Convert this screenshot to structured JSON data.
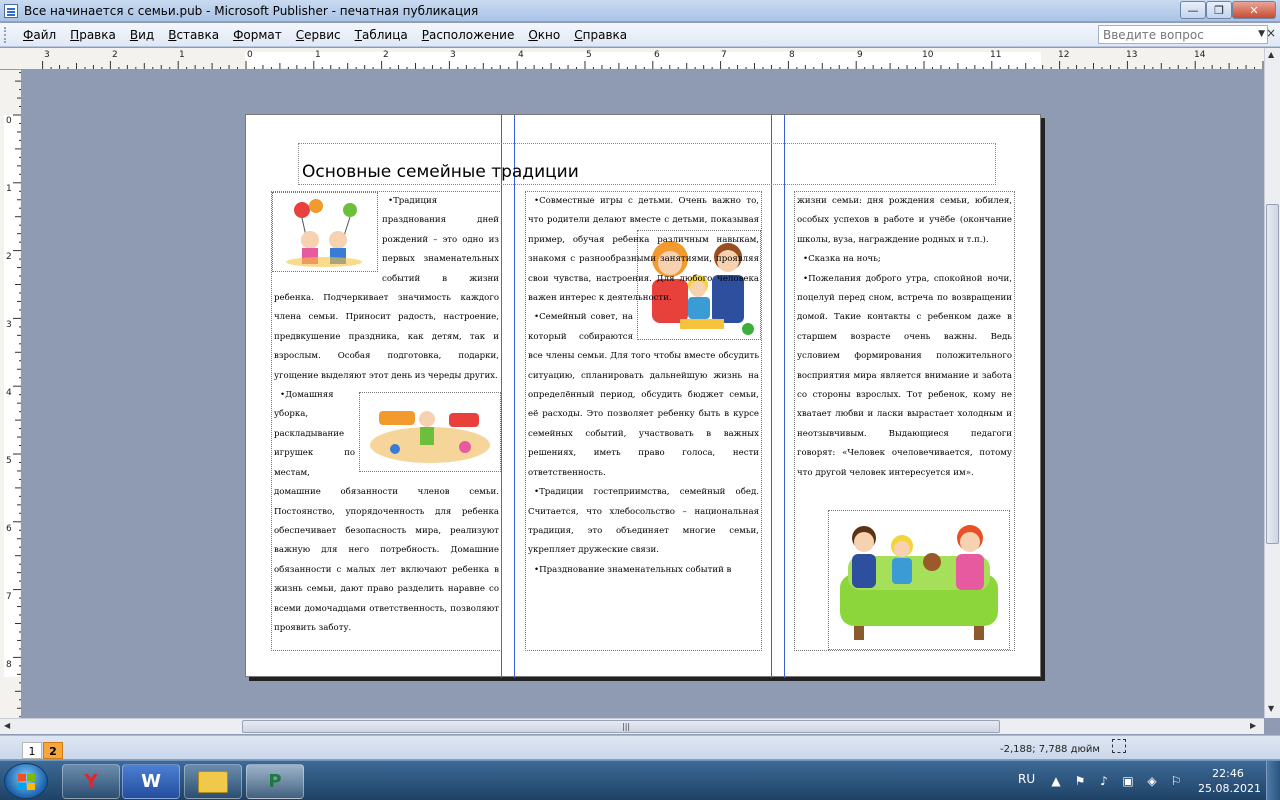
{
  "window": {
    "title": "Все начинается с семьи.pub - Microsoft Publisher - печатная публикация",
    "min_label": "—",
    "max_label": "❐",
    "close_label": "✕"
  },
  "menu": {
    "items": [
      {
        "u": "Ф",
        "rest": "айл"
      },
      {
        "u": "П",
        "rest": "равка"
      },
      {
        "u": "В",
        "rest": "ид"
      },
      {
        "u": "В",
        "rest": "ставка"
      },
      {
        "u": "Ф",
        "rest": "ормат"
      },
      {
        "u": "С",
        "rest": "ервис"
      },
      {
        "u": "Т",
        "rest": "аблица"
      },
      {
        "u": "Р",
        "rest": "асположение"
      },
      {
        "u": "О",
        "rest": "кно"
      },
      {
        "u": "С",
        "rest": "правка"
      }
    ],
    "ask_placeholder": "Введите вопрос",
    "doc_close": "×"
  },
  "ruler": {
    "h_labels": [
      "3",
      "2",
      "1",
      "0",
      "1",
      "2",
      "3",
      "4",
      "5",
      "6",
      "7",
      "8",
      "9",
      "10",
      "11",
      "12",
      "13",
      "14"
    ],
    "v_labels": [
      "0",
      "1",
      "2",
      "3",
      "4",
      "5",
      "6",
      "7",
      "8"
    ]
  },
  "document": {
    "heading": "Основные семейные традиции",
    "col1_text": "•Традиция празднования дней рождений – это одно из первых знаменательных событий в жизни ребенка. Подчеркивает значимость каждого члена семьи. Приносит радость, настроение, предвкушение праздника, как детям, так и взрослым. Особая подготовка, подарки, угощение выделяют этот день из череды других.",
    "col1_text2": "•Домашняя уборка, раскладывание игрушек по местам, домашние обязанности членов семьи. Постоянство, упорядоченность для ребенка обеспечивает безопасность мира, реализуют важную для него потребность. Домашние обязанности с малых лет включают ребенка в жизнь семьи, дают право разделить наравне со всеми домочадцами ответственность, позволяют проявить заботу.",
    "col2_text": "•Совместные игры с детьми. Очень важно то, что родители делают вместе с детьми, показывая пример, обучая ребенка различным навыкам, знакомя с разнообразными занятиями, проявляя свои чувства, настроения. Для любого человека важен интерес к деятельности.",
    "col2_text2": "•Семейный совет, на который собираются все члены семьи. Для того чтобы вместе обсудить ситуацию, спланировать дальнейшую жизнь на определённый период, обсудить бюджет семьи, её расходы. Это позволяет ребенку быть в курсе семейных событий, участвовать в важных решениях, иметь право голоса, нести ответственность.",
    "col2_text3": "•Традиции гостеприимства, семейный обед. Считается, что хлебосольство – национальная традиция, это объединяет многие семьи, укрепляет дружеские связи.",
    "col2_text4": "•Празднование знаменательных событий в",
    "col3_text": "жизни семьи: дня рождения семьи, юбилея, особых успехов в работе и учёбе (окончание школы, вуза, награждение родных и т.п.).",
    "col3_text2": "•Сказка на ночь;",
    "col3_text3": "•Пожелания доброго утра, спокойной ночи, поцелуй перед сном, встреча по возвращении домой. Такие контакты с ребенком даже в старшем возрасте очень важны. Ведь условием формирования положительного восприятия мира является внимание и забота со стороны взрослых. Тот ребенок, кому не хватает любви и ласки вырастает холодным и неотзывчивым. Выдающиеся педагоги говорят: «Человек очеловечивается, потому что другой человек интересуется им»."
  },
  "status": {
    "page1": "1",
    "page2": "2",
    "coords": "-2,188; 7,788 дюйм"
  },
  "taskbar": {
    "yandex": "Y",
    "word": "W",
    "publisher": "P",
    "lang": "RU",
    "time": "22:46",
    "date": "25.08.2021"
  }
}
